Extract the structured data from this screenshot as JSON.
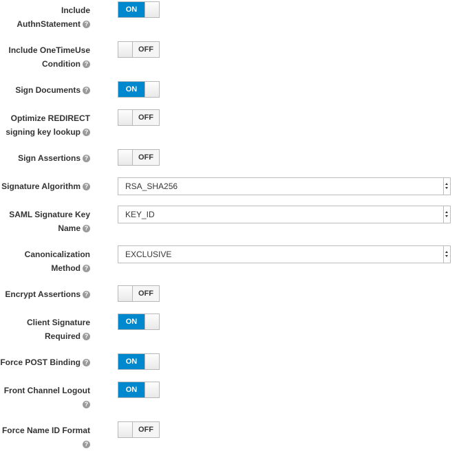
{
  "help_glyph": "?",
  "on_label": "ON",
  "off_label": "OFF",
  "fields": {
    "include_authn": {
      "label_l1": "Include",
      "label_l2": "AuthnStatement",
      "state": "ON"
    },
    "include_onetimeuse": {
      "label_l1": "Include OneTimeUse",
      "label_l2": "Condition",
      "state": "OFF"
    },
    "sign_documents": {
      "label": "Sign Documents",
      "state": "ON"
    },
    "optimize_redirect": {
      "label_l1": "Optimize REDIRECT",
      "label_l2": "signing key lookup",
      "state": "OFF"
    },
    "sign_assertions": {
      "label": "Sign Assertions",
      "state": "OFF"
    },
    "signature_algorithm": {
      "label": "Signature Algorithm",
      "value": "RSA_SHA256"
    },
    "saml_signature_key_name": {
      "label_l1": "SAML Signature Key",
      "label_l2": "Name",
      "value": "KEY_ID"
    },
    "canonicalization_method": {
      "label_l1": "Canonicalization",
      "label_l2": "Method",
      "value": "EXCLUSIVE"
    },
    "encrypt_assertions": {
      "label": "Encrypt Assertions",
      "state": "OFF"
    },
    "client_signature_required": {
      "label_l1": "Client Signature",
      "label_l2": "Required",
      "state": "ON"
    },
    "force_post_binding": {
      "label": "Force POST Binding",
      "state": "ON"
    },
    "front_channel_logout": {
      "label_l1": "Front Channel Logout",
      "label_l2": "",
      "state": "ON"
    },
    "force_name_id_format": {
      "label_l1": "Force Name ID Format",
      "label_l2": "",
      "state": "OFF"
    }
  },
  "colors": {
    "on_blue": "#0088ce",
    "border": "#b7b7b7",
    "help_gray": "#9a9a9a"
  }
}
